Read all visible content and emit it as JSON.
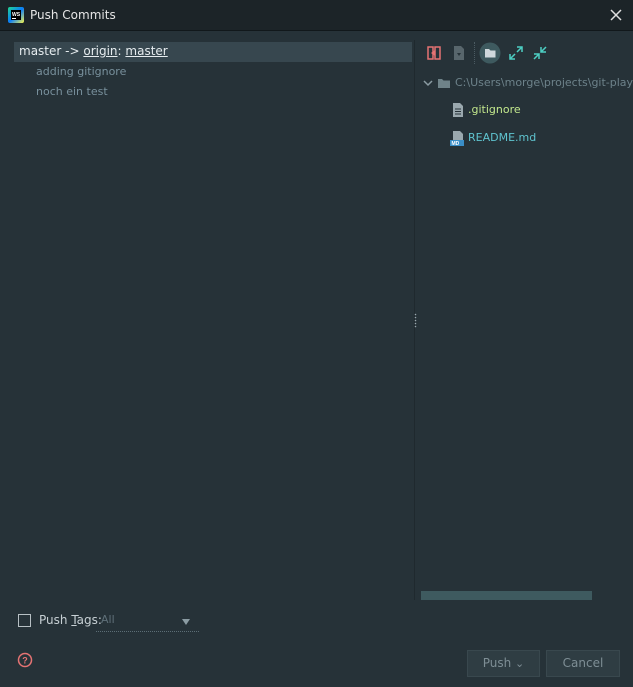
{
  "window": {
    "title": "Push Commits"
  },
  "branch": {
    "local": "master",
    "arrow": "->",
    "remote": "origin",
    "sep": ":",
    "target": "master"
  },
  "commits": [
    {
      "message": "adding gitignore"
    },
    {
      "message": "noch ein test"
    }
  ],
  "tree": {
    "root_path": "C:\\Users\\morge\\projects\\git-play",
    "files": [
      {
        "name": ".gitignore",
        "color": "#c3e88d",
        "icon": "file-icon"
      },
      {
        "name": "README.md",
        "color": "#5fc4cf",
        "icon": "markdown-file-icon"
      }
    ]
  },
  "footer": {
    "push_tags_label_pre": "Push ",
    "push_tags_label_mnemonic": "T",
    "push_tags_label_post": "ags:",
    "push_tags_checked": false,
    "tags_select_value": "All",
    "push_label": "Push",
    "push_dropdown": "⌄",
    "cancel_label": "Cancel"
  },
  "colors": {
    "background": "#263238",
    "selection": "#37474f",
    "accent_red": "#e57373",
    "accent_teal": "#4dd0c4"
  }
}
